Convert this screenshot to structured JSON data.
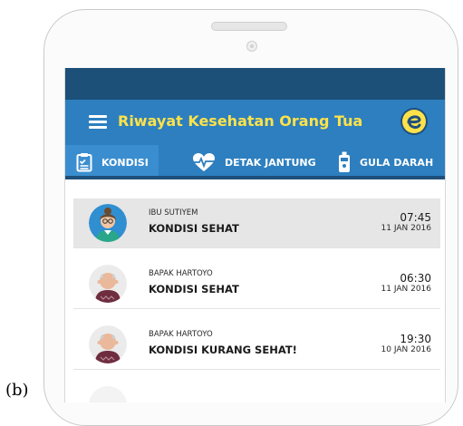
{
  "caption": "(b)",
  "app": {
    "title": "Riwayat Kesehatan Orang Tua"
  },
  "tabs": [
    {
      "label": "KONDISI",
      "icon": "clipboard-icon",
      "active": true
    },
    {
      "label": "DETAK JANTUNG",
      "icon": "heartbeat-icon",
      "active": false
    },
    {
      "label": "GULA DARAH",
      "icon": "glucose-meter-icon",
      "active": false
    }
  ],
  "entries": [
    {
      "name": "IBU SUTIYEM",
      "status": "KONDISI SEHAT",
      "time": "07:45",
      "date": "11 JAN 2016",
      "avatar": "woman-avatar",
      "selected": true
    },
    {
      "name": "BAPAK HARTOYO",
      "status": "KONDISI SEHAT",
      "time": "06:30",
      "date": "11 JAN 2016",
      "avatar": "man-avatar",
      "selected": false
    },
    {
      "name": "BAPAK HARTOYO",
      "status": "KONDISI KURANG SEHAT!",
      "time": "19:30",
      "date": "10 JAN 2016",
      "avatar": "man-avatar",
      "selected": false
    }
  ],
  "colors": {
    "statusbar": "#1c5079",
    "appbar": "#2d7fbf",
    "title": "#fde24a",
    "selected_row": "#e6e6e6"
  }
}
